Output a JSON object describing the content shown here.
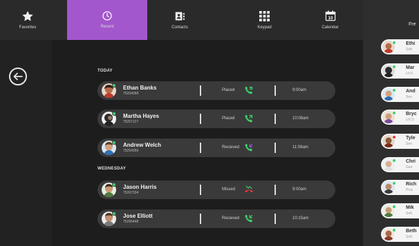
{
  "nav": {
    "favorites": "Favorites",
    "recent": "Recent",
    "contacts": "Contacts",
    "keypad": "Keypad",
    "calendar": "Calendar",
    "calendar_day": "10"
  },
  "recent": {
    "sections": [
      {
        "header": "TODAY",
        "calls": [
          {
            "name": "Ethan Banks",
            "number": "75264068",
            "type": "Placed",
            "time": "9:00am",
            "direction": "placed"
          },
          {
            "name": "Martha Hayes",
            "number": "75267127",
            "type": "Placed",
            "time": "10:08am",
            "direction": "placed"
          },
          {
            "name": "Andrew Welch",
            "number": "75264356",
            "type": "Recieved",
            "time": "11:08am",
            "direction": "received"
          }
        ]
      },
      {
        "header": "WEDNESDAY",
        "calls": [
          {
            "name": "Jason Harris",
            "number": "75267334",
            "type": "Missed",
            "time": "9:00am",
            "direction": "missed"
          },
          {
            "name": "Jose Elliott",
            "number": "75265448",
            "type": "Recieved",
            "time": "10:15am",
            "direction": "received"
          }
        ]
      }
    ]
  },
  "favorites": {
    "title": "Fre",
    "items": [
      {
        "name": "Ethi",
        "sub": "Soft",
        "status": "#3cd26a"
      },
      {
        "name": "Mar",
        "sub": "UI D",
        "status": "#3cd26a"
      },
      {
        "name": "And",
        "sub": "Sen",
        "status": "#3cd26a"
      },
      {
        "name": "Bryc",
        "sub": "UX D",
        "status": "#3cd26a"
      },
      {
        "name": "Tyle",
        "sub": "Sen",
        "status": "#e53935"
      },
      {
        "name": "Chri",
        "sub": "Gen",
        "status": "#3cd26a"
      },
      {
        "name": "Rich",
        "sub": "Proc",
        "status": "#3cd26a"
      },
      {
        "name": "Mik",
        "sub": "Soft",
        "status": "#3cd26a"
      },
      {
        "name": "Beth",
        "sub": "Soft",
        "status": "#3cd26a"
      }
    ]
  },
  "colors": {
    "accent": "#a357cc",
    "status_online": "#3cd26a",
    "call_placed": "#3cd26a",
    "call_missed": "#e53935"
  }
}
